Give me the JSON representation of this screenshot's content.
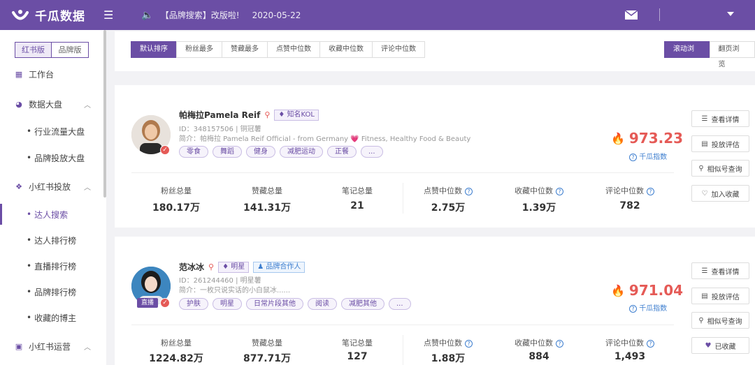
{
  "header": {
    "app_name": "千瓜数据",
    "announcement": "【品牌搜索】改版啦!",
    "announcement_date": "2020-05-22"
  },
  "sidebar": {
    "segments": [
      "红书版",
      "品牌版"
    ],
    "items": [
      {
        "label": "工作台",
        "icon": "grid-icon"
      },
      {
        "label": "数据大盘",
        "icon": "pie-chart-icon",
        "children": [
          "行业流量大盘",
          "品牌投放大盘"
        ]
      },
      {
        "label": "小红书投放",
        "icon": "cube-icon",
        "children": [
          "达人搜索",
          "达人排行榜",
          "直播排行榜",
          "品牌排行榜",
          "收藏的博主"
        ]
      },
      {
        "label": "小红书运营",
        "icon": "chat-icon"
      }
    ],
    "active": "达人搜索"
  },
  "sort_tabs": [
    "默认排序",
    "粉丝最多",
    "赞藏最多",
    "点赞中位数",
    "收藏中位数",
    "评论中位数"
  ],
  "view_tabs": [
    "滚动浏览",
    "翻页浏览"
  ],
  "stat_labels": [
    "粉丝总量",
    "赞藏总量",
    "笔记总量",
    "点赞中位数",
    "收藏中位数",
    "评论中位数"
  ],
  "score_label": "千瓜指数",
  "actions": {
    "detail": "查看详情",
    "evaluate": "投放评估",
    "similar": "相似号查询",
    "favorite": "加入收藏",
    "favorited": "已收藏"
  },
  "bloggers": [
    {
      "name": "帕梅拉Pamela Reif",
      "tags": [
        "知名KOL"
      ],
      "id_line": "ID：348157506 | 铜冠薯",
      "intro": "简介：帕梅拉 Pamela Reif Official - from Germany 💗 Fitness, Healthy Food & Beauty",
      "chips": [
        "零食",
        "舞蹈",
        "健身",
        "减肥运动",
        "正餐",
        "..."
      ],
      "score": "973.23",
      "stats": [
        "180.17万",
        "141.31万",
        "21",
        "2.75万",
        "1.39万",
        "782"
      ],
      "live": ""
    },
    {
      "name": "范冰冰",
      "tags": [
        "明星",
        "品牌合作人"
      ],
      "id_line": "ID：261244460 | 明星薯",
      "intro": "简介：一枚只说实话的小白鼠冰......",
      "chips": [
        "护肤",
        "明星",
        "日常片段其他",
        "阅读",
        "减肥其他",
        "..."
      ],
      "score": "971.04",
      "stats": [
        "1224.82万",
        "877.71万",
        "127",
        "1.88万",
        "884",
        "1,493"
      ],
      "live": "直播"
    }
  ],
  "colors": {
    "brand": "#6b4ea5",
    "score": "#e55a56",
    "link": "#3d7ecf"
  }
}
